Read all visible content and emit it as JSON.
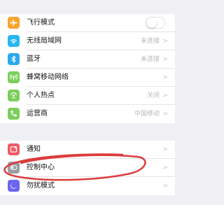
{
  "colors": {
    "airplane": "#f8a32c",
    "wifi": "#27b6f2",
    "bluetooth": "#2aa8ee",
    "cellular": "#7ccf5b",
    "hotspot": "#7ccf5b",
    "carrier": "#7ccf5b",
    "notification": "#f05a64",
    "control_center": "#9b9ba2",
    "dnd": "#6d63f0",
    "annotation": "#dc3c3c"
  },
  "group1": {
    "rows": [
      {
        "label": "飞行模式",
        "value": "",
        "icon": "airplane-icon",
        "toggle": false
      },
      {
        "label": "无线局域网",
        "value": "未连接",
        "icon": "wifi-icon"
      },
      {
        "label": "蓝牙",
        "value": "未连接",
        "icon": "bluetooth-icon"
      },
      {
        "label": "蜂窝移动网络",
        "value": "",
        "icon": "cellular-icon"
      },
      {
        "label": "个人热点",
        "value": "关闭",
        "icon": "hotspot-icon"
      },
      {
        "label": "运营商",
        "value": "中国移动",
        "icon": "carrier-icon"
      }
    ]
  },
  "group2": {
    "rows": [
      {
        "label": "通知",
        "value": "",
        "icon": "notification-icon"
      },
      {
        "label": "控制中心",
        "value": "",
        "icon": "control-center-icon"
      },
      {
        "label": "勿扰模式",
        "value": "",
        "icon": "moon-icon"
      }
    ]
  },
  "chevron": ">"
}
